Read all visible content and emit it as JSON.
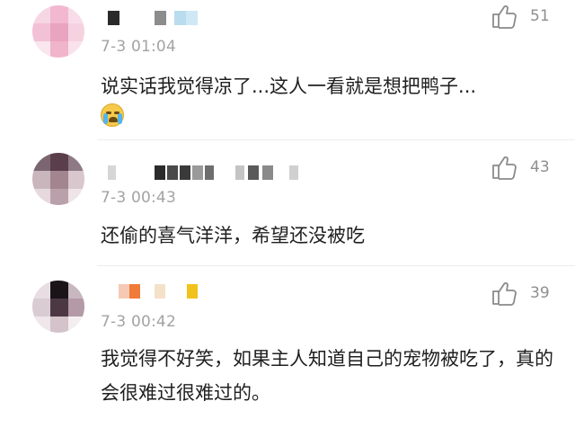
{
  "comments": [
    {
      "time": "7-3 01:04",
      "text": "说实话我觉得凉了...这人一看就是想把鸭子...",
      "emoji_icon": "crying-face-icon",
      "likes": "51"
    },
    {
      "time": "7-3 00:43",
      "text": "还偷的喜气洋洋，希望还没被吃",
      "likes": "43"
    },
    {
      "time": "7-3 00:42",
      "text": "我觉得不好笑，如果主人知道自己的宠物被吃了，真的会很难过很难过的。",
      "likes": "39"
    }
  ],
  "icons": {
    "like": "thumbs-up-icon"
  },
  "colors": {
    "time": "#a3a3a3",
    "count": "#8f8f8f",
    "text": "#1f1f1f"
  }
}
